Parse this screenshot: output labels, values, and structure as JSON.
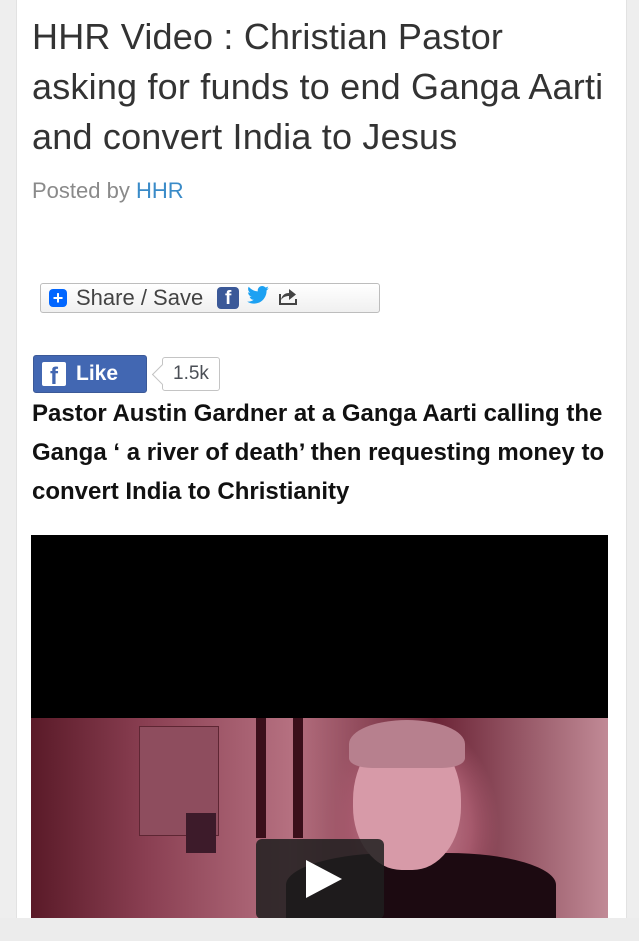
{
  "article": {
    "title": "HHR Video : Christian Pastor asking for funds to end Ganga Aarti and convert India to Jesus",
    "byline_prefix": "Posted by ",
    "author": "HHR"
  },
  "share": {
    "label": "Share / Save",
    "icons": [
      "plus-icon",
      "facebook-icon",
      "twitter-icon",
      "forward-icon"
    ]
  },
  "facebook": {
    "like_label": "Like",
    "like_count": "1.5k"
  },
  "lead": "Pastor Austin Gardner at a Ganga Aarti calling the Ganga ‘ a river of death’ then requesting money to convert India to Christianity",
  "video": {
    "play_icon": "play-icon"
  },
  "colors": {
    "link": "#3a8bc8",
    "facebook": "#4267b2",
    "share_plus": "#0166ff",
    "twitter": "#1da1f2"
  }
}
